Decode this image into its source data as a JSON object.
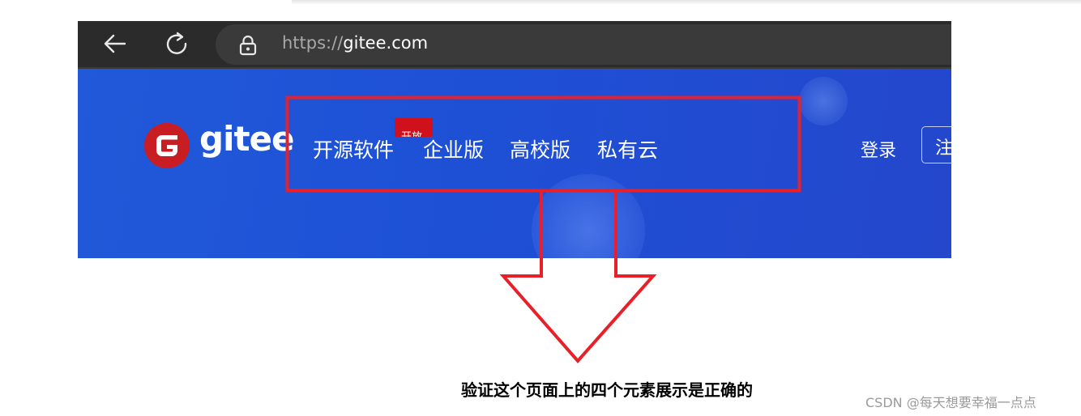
{
  "browser": {
    "url_protocol": "https://",
    "url_host": "gitee.com",
    "icons": [
      "back-arrow-icon",
      "reload-icon",
      "lock-icon"
    ]
  },
  "site": {
    "logo_text": "gitee",
    "nav_items": [
      "开源软件",
      "企业版",
      "高校版",
      "私有云"
    ],
    "badge_text": "开放",
    "login_label": "登录",
    "register_label": "注册"
  },
  "annotation": {
    "note": "验证这个页面上的四个元素展示是正确的",
    "highlight_color": "#e8202a"
  },
  "watermark": "CSDN @每天想要幸福一点点",
  "colors": {
    "brand_blue": "#1e50d6",
    "brand_red": "#c71d23",
    "browser_bar": "#2b2b2b"
  }
}
